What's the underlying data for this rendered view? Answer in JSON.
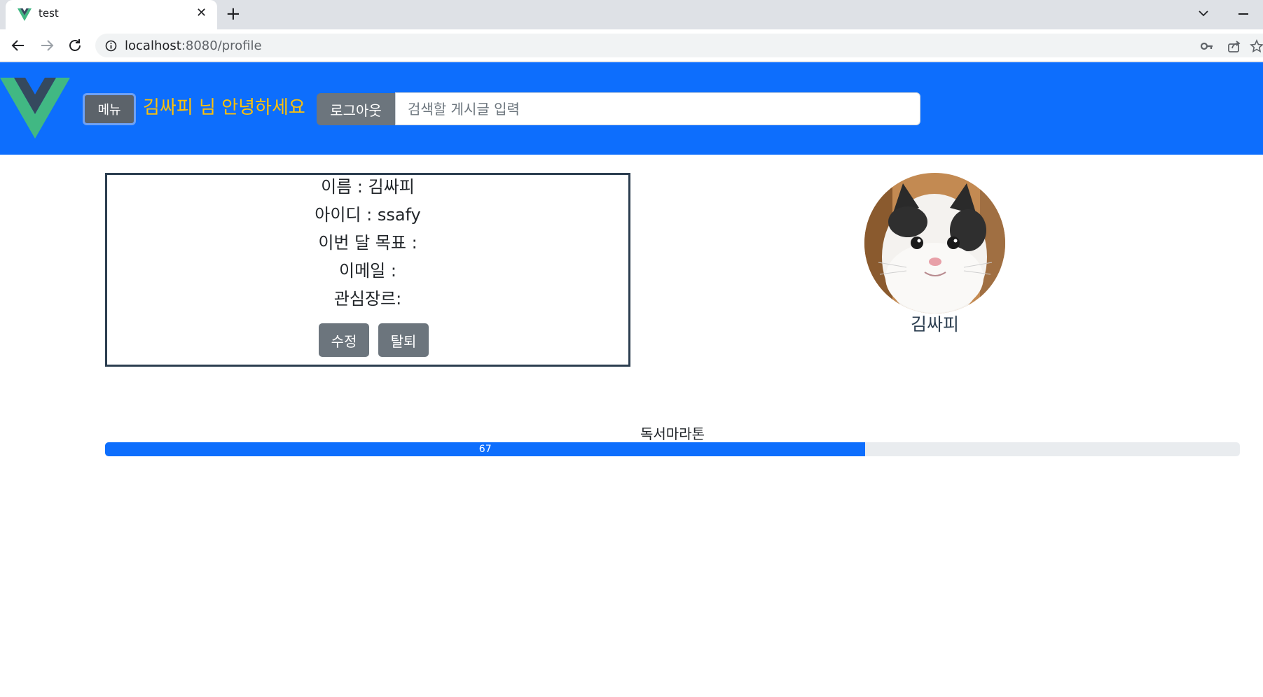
{
  "browser": {
    "tab_title": "test",
    "url_host": "localhost",
    "url_rest": ":8080/profile"
  },
  "header": {
    "menu_label": "메뉴",
    "greeting": "김싸피 님 안녕하세요",
    "logout_label": "로그아웃",
    "search_placeholder": "검색할 게시글 입력"
  },
  "profile": {
    "name_line": "이름 : 김싸피",
    "id_line": "아이디 : ssafy",
    "goal_line": "이번 달 목표 :",
    "email_line": "이메일 :",
    "genre_line": "관심장르:",
    "edit_label": "수정",
    "withdraw_label": "탈퇴"
  },
  "avatar": {
    "name": "김싸피"
  },
  "progress": {
    "label": "독서마라톤",
    "value": 67,
    "value_text": "67",
    "max": 100
  },
  "colors": {
    "primary": "#0d6efd",
    "secondary": "#6c757d",
    "greeting": "#ffc107",
    "card_border": "#2c3e50"
  }
}
